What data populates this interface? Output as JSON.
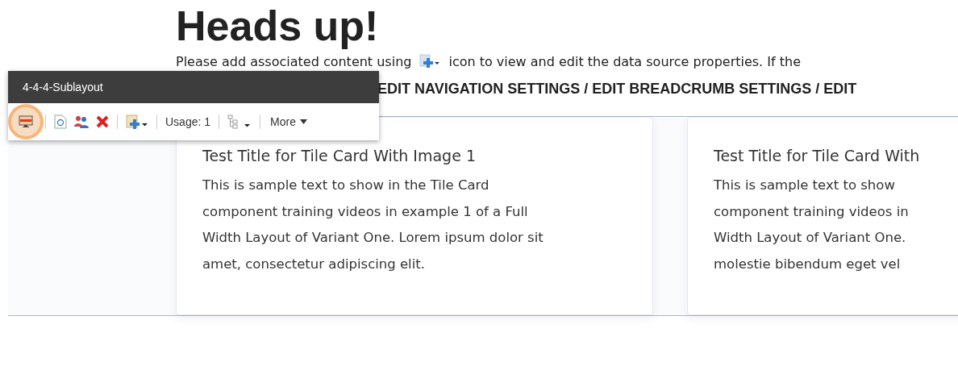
{
  "heading": "Heads up!",
  "notice": {
    "before": "Please add associated content using",
    "after": "icon to view and edit the data source properties. If the"
  },
  "edit_links": "EDIT NAVIGATION SETTINGS / EDIT BREADCRUMB SETTINGS / EDIT",
  "toolbar": {
    "title": "4-4-4-Sublayout",
    "items": [
      {
        "kind": "monitor",
        "selected": true
      },
      {
        "kind": "sep"
      },
      {
        "kind": "refresh",
        "selected": false
      },
      {
        "kind": "people",
        "selected": false
      },
      {
        "kind": "delete",
        "selected": false
      },
      {
        "kind": "sep"
      },
      {
        "kind": "add",
        "selected": false
      },
      {
        "kind": "sep"
      },
      {
        "kind": "text",
        "label": "Usage: 1"
      },
      {
        "kind": "sep"
      },
      {
        "kind": "tree",
        "selected": false
      },
      {
        "kind": "sep"
      },
      {
        "kind": "menu",
        "label": "More"
      }
    ]
  },
  "cards": [
    {
      "title": "Test Title for Tile Card With Image 1",
      "lines": [
        "This is sample text to show in the Tile Card",
        "component training videos in example 1 of a Full",
        "Width Layout of Variant One. Lorem ipsum dolor sit",
        "amet, consectetur adipiscing elit."
      ]
    },
    {
      "title": "Test Title for Tile Card With",
      "lines": [
        "This is sample text to show",
        "component training videos in",
        "Width Layout of Variant One.",
        "molestie bibendum eget vel"
      ]
    }
  ]
}
